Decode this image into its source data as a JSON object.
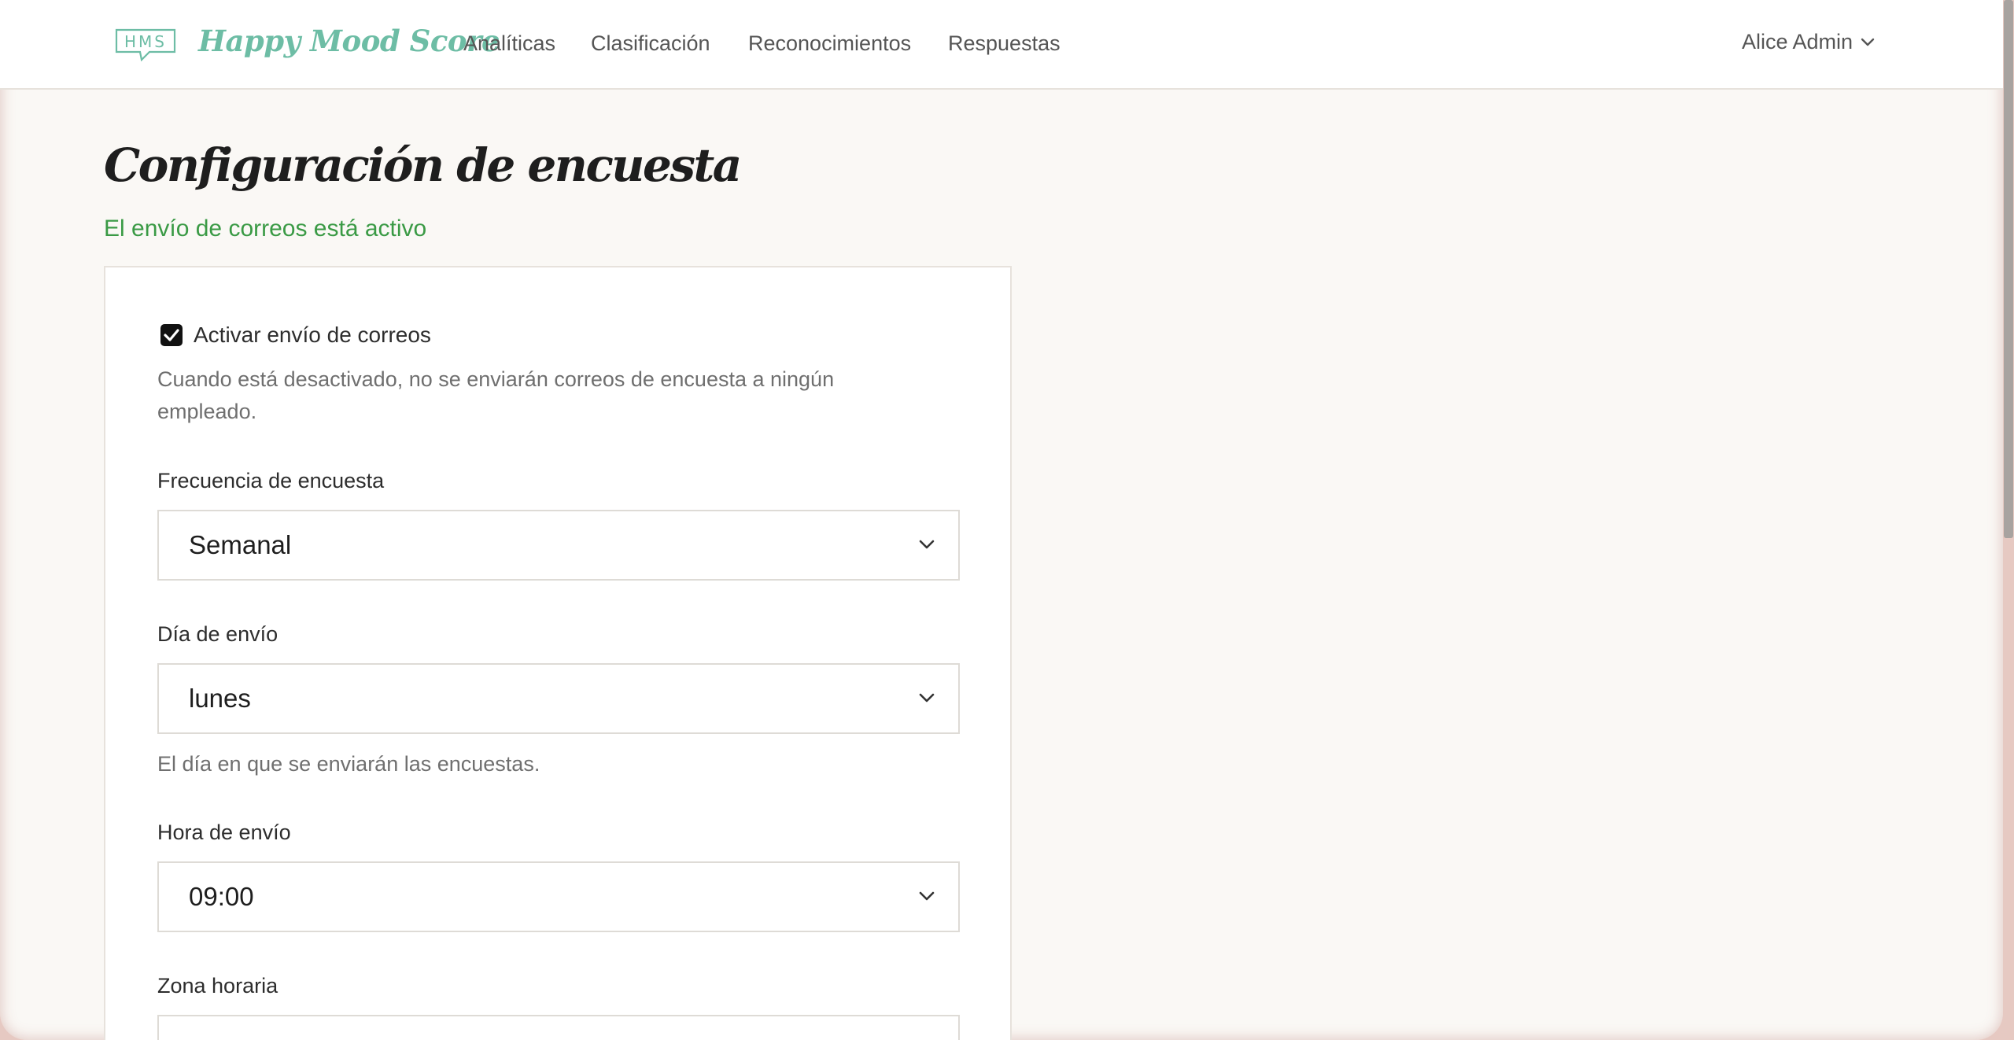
{
  "nav": {
    "logo_text": "HMS",
    "brand": "Happy Mood Score",
    "links": [
      "Analíticas",
      "Clasificación",
      "Reconocimientos",
      "Respuestas"
    ],
    "user": "Alice Admin",
    "user_icon": "chevron-down-icon"
  },
  "page": {
    "title": "Configuración de encuesta",
    "status": "El envío de correos está activo",
    "status_color": "#3a9a45"
  },
  "form": {
    "enable_label": "Activar envío de correos",
    "enable_checked": true,
    "enable_help": "Cuando está desactivado, no se enviarán correos de encuesta a ningún empleado.",
    "frequency_label": "Frecuencia de encuesta",
    "frequency_value": "Semanal",
    "day_label": "Día de envío",
    "day_value": "lunes",
    "day_help": "El día en que se enviarán las encuestas.",
    "time_label": "Hora de envío",
    "time_value": "09:00",
    "timezone_label": "Zona horaria"
  },
  "colors": {
    "brand": "#6dbda5",
    "background": "#faf8f5"
  }
}
